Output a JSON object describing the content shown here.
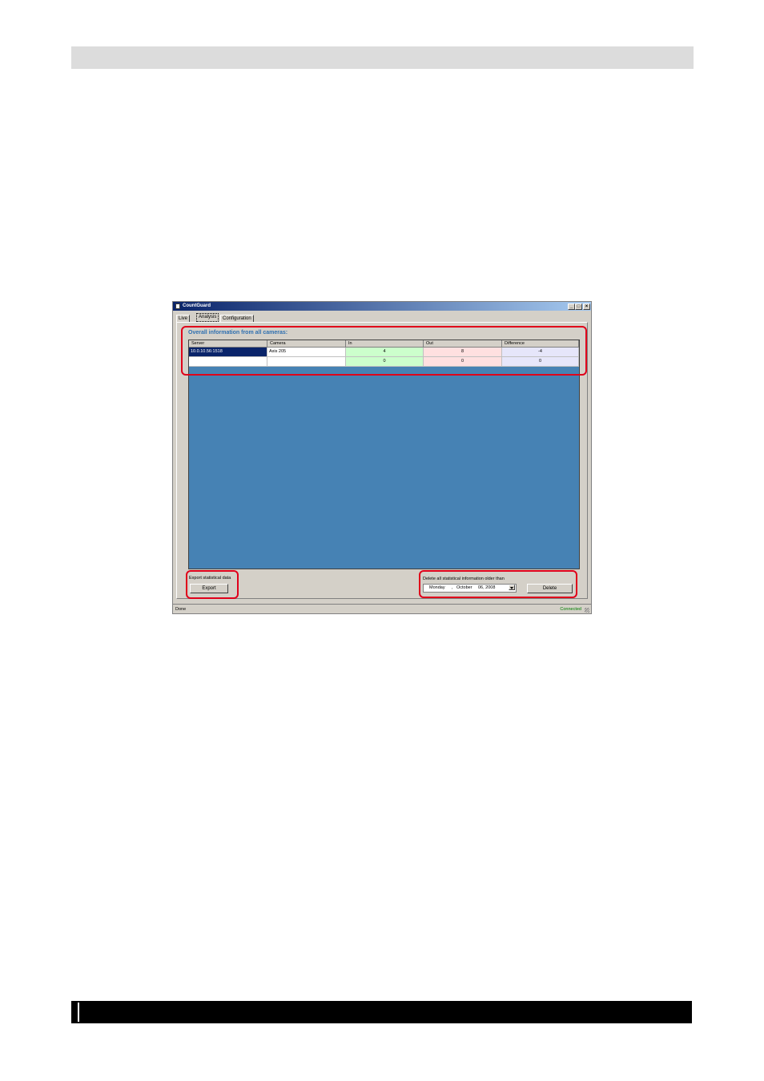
{
  "window": {
    "title": "CountGuard",
    "minimize": "_",
    "maximize": "□",
    "close": "×"
  },
  "tabs": [
    "Live",
    "Analysis",
    "Configuration"
  ],
  "overall": {
    "title": "Overall information from all cameras:",
    "columns": [
      "Server",
      "Camera",
      "In",
      "Out",
      "Difference"
    ],
    "rows": [
      {
        "server": "10.0.10.56:1518",
        "camera": "Axis 205",
        "in": "4",
        "out": "8",
        "difference": "-4"
      },
      {
        "server": "",
        "camera": "",
        "in": "0",
        "out": "0",
        "difference": "0"
      }
    ]
  },
  "export": {
    "label": "Export statistical data",
    "button": "Export"
  },
  "delete": {
    "label": "Delete all statistical information older than",
    "date_day": "Monday",
    "date_sep": ",",
    "date_month": "October",
    "date_rest": "06, 2008",
    "button": "Delete"
  },
  "status": {
    "left": "Done",
    "right": "Connected"
  },
  "colors": {
    "grid_background": "#4682b4",
    "highlight": "#e0001a",
    "in_cell": "#ccffcc",
    "out_cell": "#ffe0e0",
    "difference_cell": "#e6e6fa"
  }
}
